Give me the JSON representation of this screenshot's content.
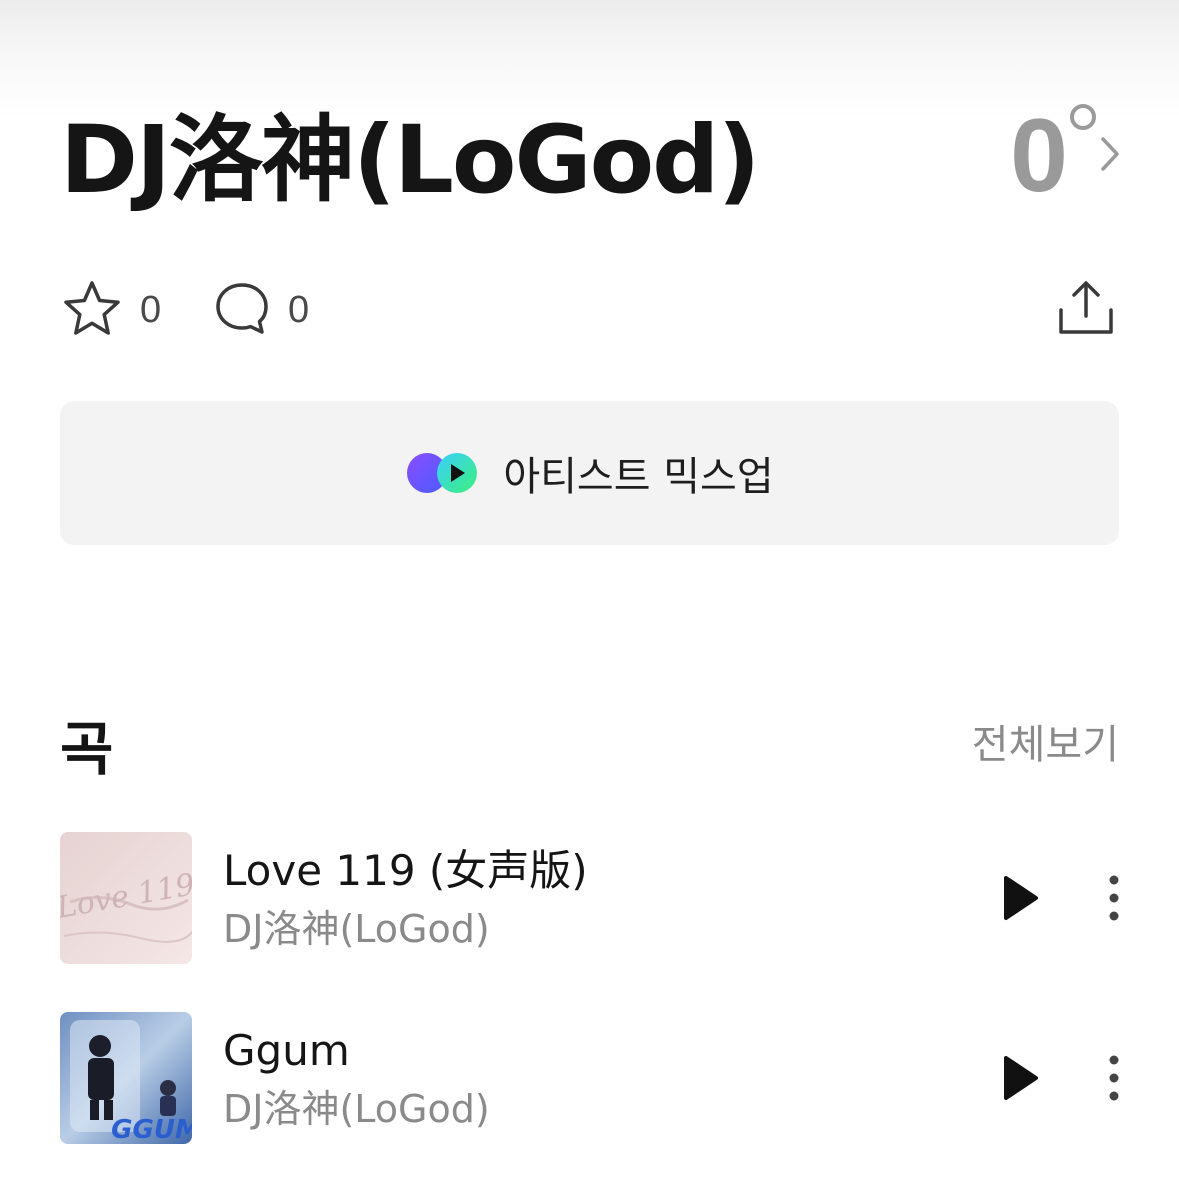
{
  "artist": {
    "name": "DJ洛神(LoGod)",
    "temperature": "0"
  },
  "stats": {
    "likes": "0",
    "comments": "0"
  },
  "mixup": {
    "label": "아티스트 믹스업"
  },
  "songs_section": {
    "title": "곡",
    "see_all": "전체보기"
  },
  "songs": [
    {
      "title": "Love 119 (女声版)",
      "artist": "DJ洛神(LoGod)",
      "art_text": "Love 119"
    },
    {
      "title": "Ggum",
      "artist": "DJ洛神(LoGod)",
      "art_text": "GGUM"
    }
  ],
  "icons": {
    "like": "star-outline-icon",
    "comment": "speech-bubble-icon",
    "share": "share-upload-icon",
    "play": "play-icon",
    "more": "more-vertical-icon",
    "chevron": "chevron-right-icon",
    "mixup": "mixup-logo-icon"
  },
  "colors": {
    "primary_text": "#151515",
    "secondary_text": "#8a8a8a",
    "temperature": "#9a9a9a",
    "button_bg": "#f3f3f3"
  }
}
